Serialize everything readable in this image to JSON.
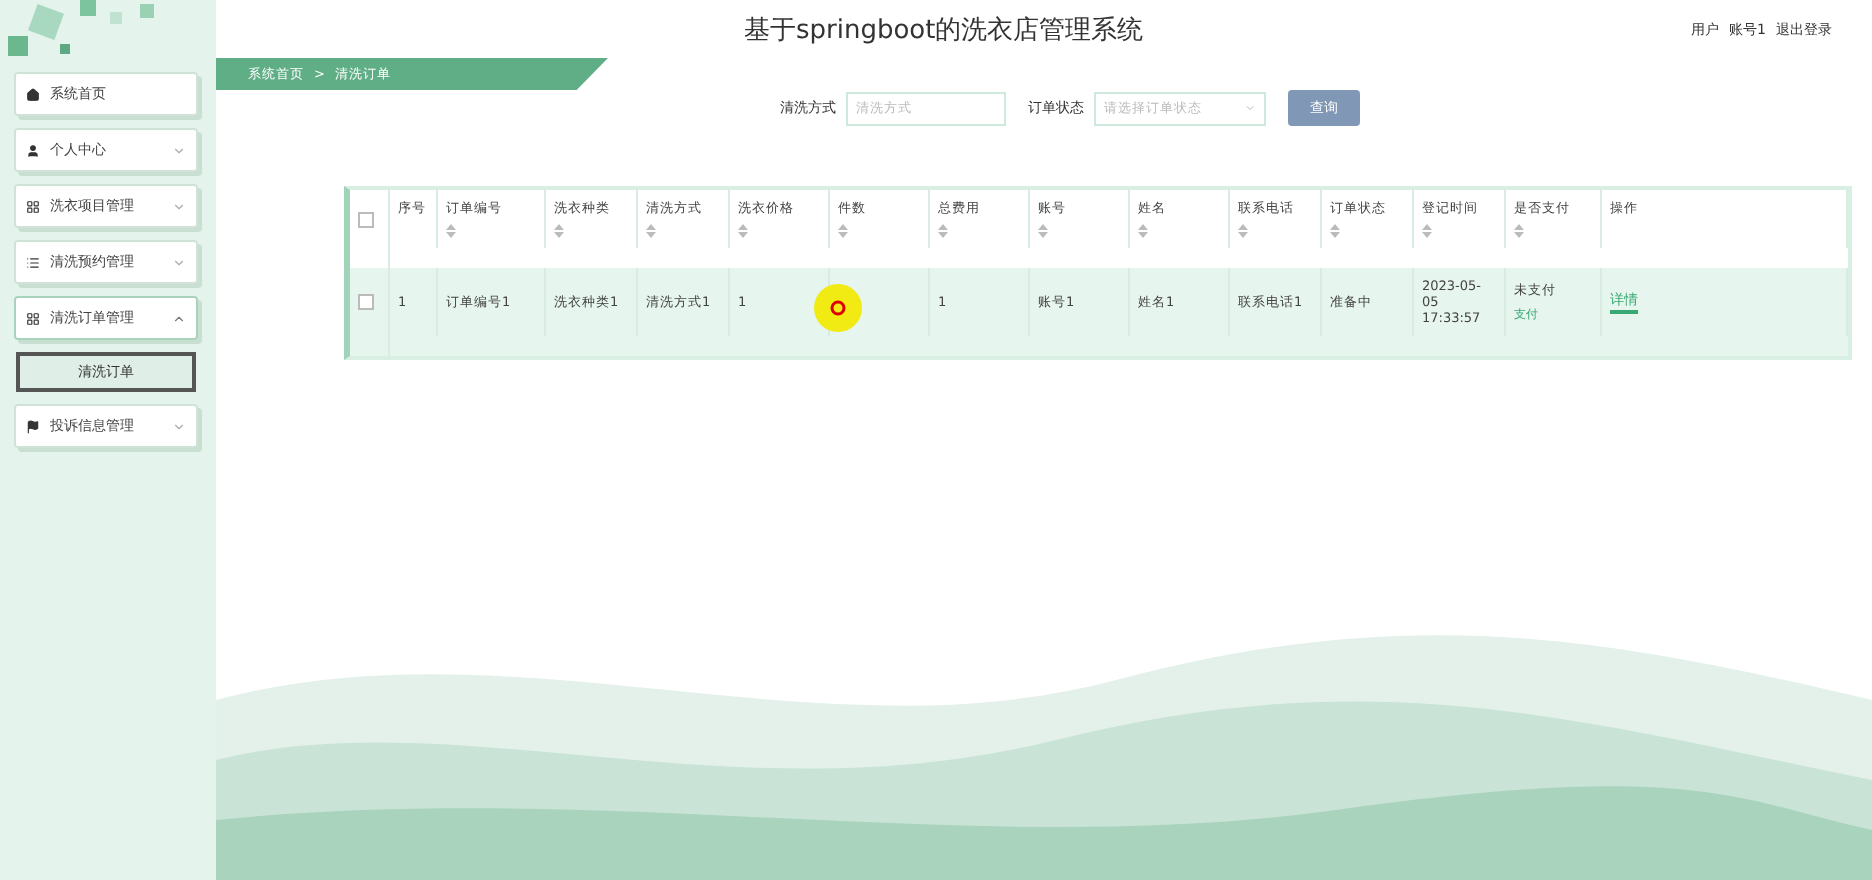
{
  "header": {
    "title": "基于springboot的洗衣店管理系统",
    "user_label": "用户",
    "user_name": "账号1",
    "logout": "退出登录"
  },
  "sidebar": {
    "items": [
      {
        "label": "系统首页",
        "kind": "home",
        "expandable": false
      },
      {
        "label": "个人中心",
        "kind": "user",
        "expandable": true,
        "expanded": false
      },
      {
        "label": "洗衣项目管理",
        "kind": "grid",
        "expandable": true,
        "expanded": false
      },
      {
        "label": "清洗预约管理",
        "kind": "list",
        "expandable": true,
        "expanded": false
      },
      {
        "label": "清洗订单管理",
        "kind": "grid",
        "expandable": true,
        "expanded": true,
        "children": [
          {
            "label": "清洗订单",
            "selected": true
          }
        ]
      },
      {
        "label": "投诉信息管理",
        "kind": "flag",
        "expandable": true,
        "expanded": false
      }
    ]
  },
  "breadcrumb": {
    "items": [
      "系统首页",
      "清洗订单"
    ],
    "separator": ">"
  },
  "search": {
    "fields": [
      {
        "label": "清洗方式",
        "placeholder": "清洗方式",
        "kind": "text"
      },
      {
        "label": "订单状态",
        "placeholder": "请选择订单状态",
        "kind": "select"
      }
    ],
    "button": "查询"
  },
  "table": {
    "all_checked": false,
    "columns": [
      {
        "label": "序号",
        "sortable": false
      },
      {
        "label": "订单编号",
        "sortable": true
      },
      {
        "label": "洗衣种类",
        "sortable": true
      },
      {
        "label": "清洗方式",
        "sortable": true
      },
      {
        "label": "洗衣价格",
        "sortable": true
      },
      {
        "label": "件数",
        "sortable": true
      },
      {
        "label": "总费用",
        "sortable": true
      },
      {
        "label": "账号",
        "sortable": true
      },
      {
        "label": "姓名",
        "sortable": true
      },
      {
        "label": "联系电话",
        "sortable": true
      },
      {
        "label": "订单状态",
        "sortable": true
      },
      {
        "label": "登记时间",
        "sortable": true
      },
      {
        "label": "是否支付",
        "sortable": true
      },
      {
        "label": "操作",
        "sortable": false
      }
    ],
    "rows": [
      {
        "checked": false,
        "cells": [
          "1",
          "订单编号1",
          "洗衣种类1",
          "清洗方式1",
          "1",
          null,
          "1",
          "账号1",
          "姓名1",
          "联系电话1",
          "准备中",
          "2023-05-05 17:33:57",
          "未支付"
        ],
        "pay_link": "支付",
        "action": "详情"
      }
    ]
  }
}
